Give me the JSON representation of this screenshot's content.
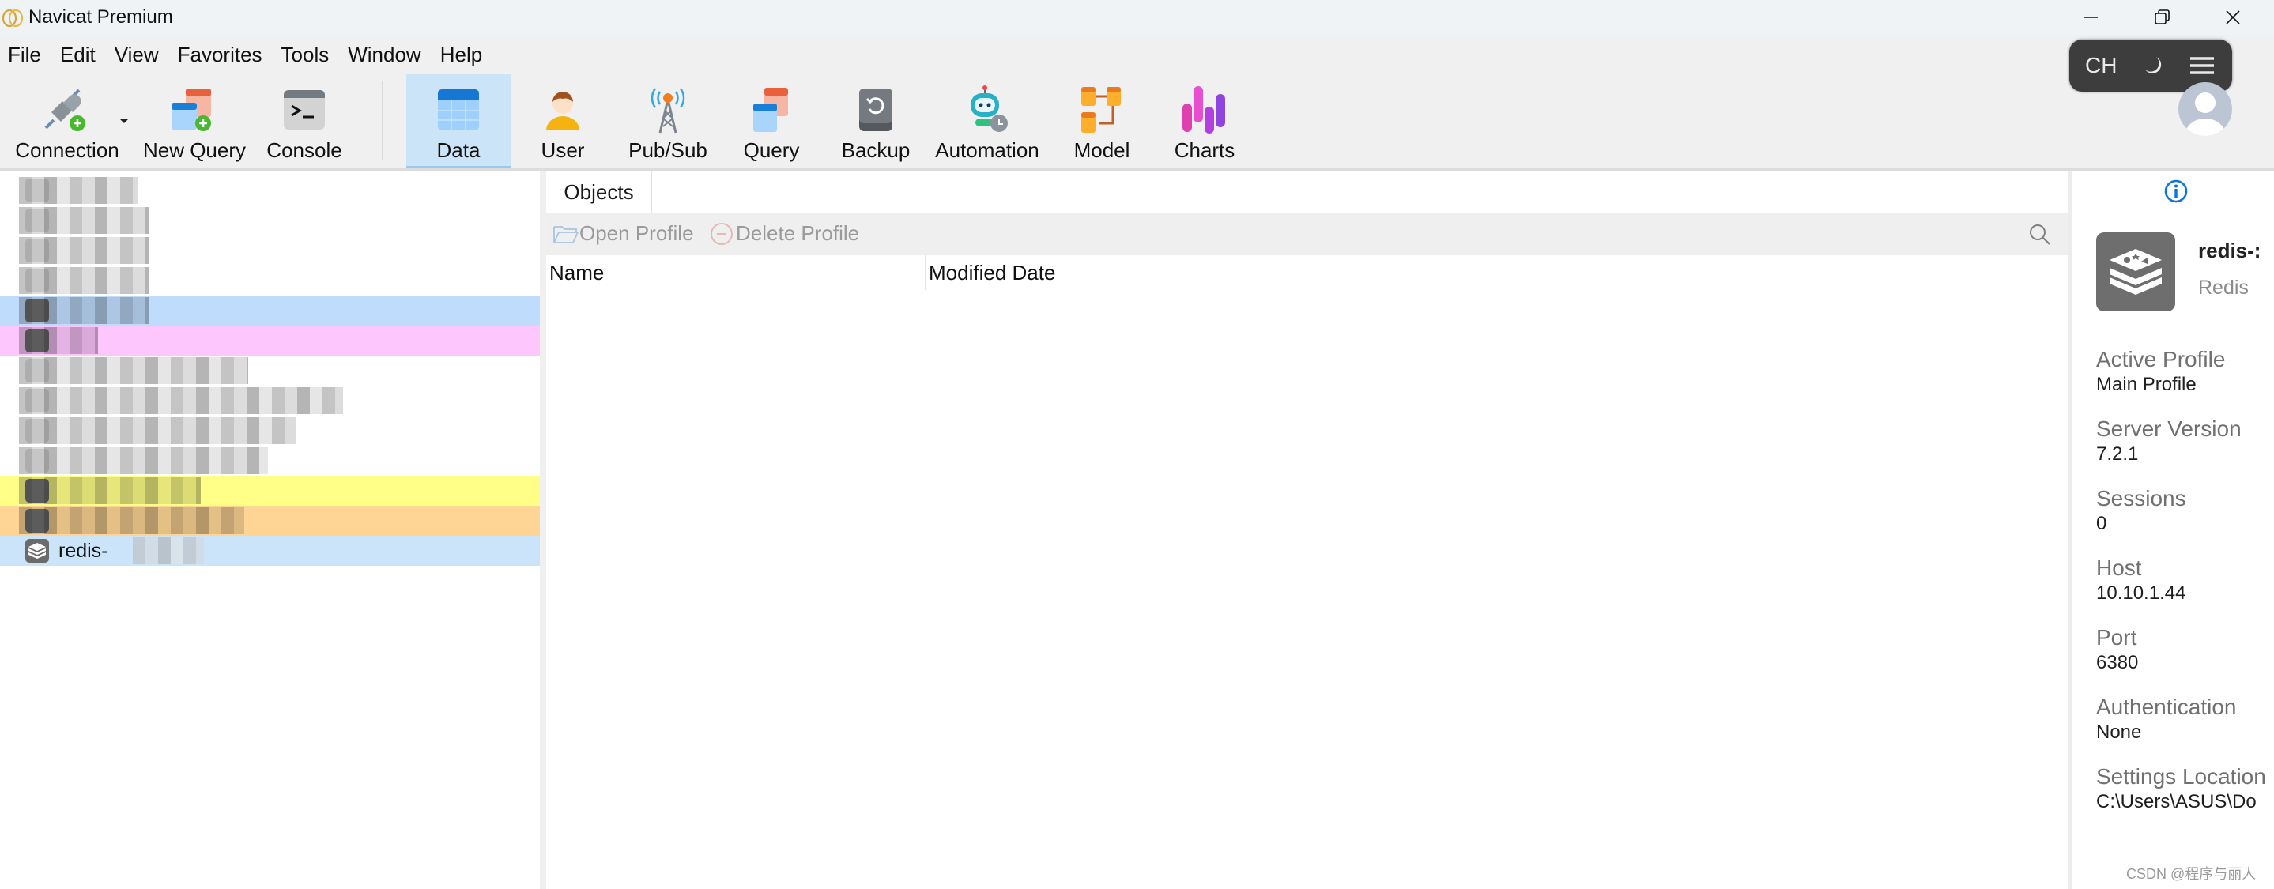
{
  "window": {
    "title": "Navicat Premium",
    "controls": [
      "minimize",
      "restore",
      "close"
    ]
  },
  "menu": {
    "items": [
      "File",
      "Edit",
      "View",
      "Favorites",
      "Tools",
      "Window",
      "Help"
    ]
  },
  "toolbar": {
    "buttons": [
      {
        "label": "Connection",
        "icon": "connection-plug-icon",
        "has_dropdown": true
      },
      {
        "label": "New Query",
        "icon": "new-query-icon"
      },
      {
        "label": "Console",
        "icon": "console-icon"
      },
      {
        "label": "Data",
        "icon": "data-table-icon",
        "active": true
      },
      {
        "label": "User",
        "icon": "user-icon"
      },
      {
        "label": "Pub/Sub",
        "icon": "pubsub-tower-icon"
      },
      {
        "label": "Query",
        "icon": "query-icon"
      },
      {
        "label": "Backup",
        "icon": "backup-icon"
      },
      {
        "label": "Automation",
        "icon": "automation-robot-icon"
      },
      {
        "label": "Model",
        "icon": "model-icon"
      },
      {
        "label": "Charts",
        "icon": "charts-icon"
      }
    ]
  },
  "overlay": {
    "ime_language": "CH",
    "icons": [
      "moon-icon",
      "hamburger-menu-icon"
    ]
  },
  "tree": {
    "items": [
      {
        "label": "",
        "obscured": true,
        "highlight": null
      },
      {
        "label": "",
        "obscured": true,
        "highlight": null
      },
      {
        "label": "",
        "obscured": true,
        "highlight": null
      },
      {
        "label": "",
        "obscured": true,
        "highlight": null
      },
      {
        "label": "",
        "obscured": true,
        "highlight": "#bfdcfc"
      },
      {
        "label": "",
        "obscured": true,
        "highlight": "#fdc6fd"
      },
      {
        "label": "",
        "obscured": true,
        "highlight": null
      },
      {
        "label": "",
        "obscured": true,
        "highlight": null
      },
      {
        "label": "",
        "obscured": true,
        "highlight": null
      },
      {
        "label": "",
        "obscured": true,
        "highlight": null
      },
      {
        "label": "",
        "obscured": true,
        "highlight": "#ffff88"
      },
      {
        "label": "",
        "obscured": true,
        "highlight": "#fed594"
      },
      {
        "label": "redis-",
        "obscured": true,
        "highlight": "#cce4f9",
        "selected": true,
        "icon": "redis-icon"
      }
    ]
  },
  "objects": {
    "tab_label": "Objects",
    "actions": {
      "open_profile": "Open Profile",
      "delete_profile": "Delete Profile"
    },
    "columns": [
      "Name",
      "Modified Date"
    ],
    "rows": []
  },
  "info_panel": {
    "connection_name": "redis-:",
    "connection_type": "Redis",
    "properties": [
      {
        "key": "Active Profile",
        "value": "Main Profile"
      },
      {
        "key": "Server Version",
        "value": "7.2.1"
      },
      {
        "key": "Sessions",
        "value": "0"
      },
      {
        "key": "Host",
        "value": "10.10.1.44"
      },
      {
        "key": "Port",
        "value": "6380"
      },
      {
        "key": "Authentication",
        "value": "None"
      },
      {
        "key": "Settings Location",
        "value": "C:\\Users\\ASUS\\Do"
      }
    ]
  },
  "watermark": "CSDN @程序与丽人",
  "colors": {
    "accent": "#0a74da",
    "active_tab_bg": "#cce4f7",
    "selection": "#cce4f9"
  }
}
